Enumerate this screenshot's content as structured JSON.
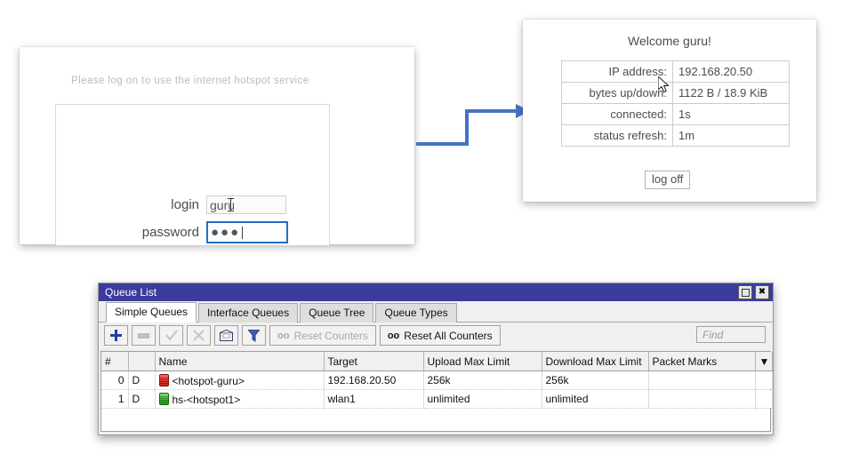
{
  "login_panel": {
    "heading": "Please log on to use the internet hotspot service",
    "login_label": "login",
    "login_value": "guru",
    "password_label": "password",
    "password_value": "●●●"
  },
  "status_panel": {
    "title": "Welcome guru!",
    "rows": [
      {
        "key": "IP address:",
        "value": "192.168.20.50"
      },
      {
        "key": "bytes up/down:",
        "value": "1122 B / 18.9 KiB"
      },
      {
        "key": "connected:",
        "value": "1s"
      },
      {
        "key": "status refresh:",
        "value": "1m"
      }
    ],
    "logoff_label": "log off"
  },
  "connector": {
    "color": "#4472c4"
  },
  "queue_window": {
    "title": "Queue List",
    "window_buttons": {
      "maximize": "maximize-icon",
      "close": "✖"
    },
    "tabs": [
      {
        "label": "Simple Queues",
        "active": true
      },
      {
        "label": "Interface Queues",
        "active": false
      },
      {
        "label": "Queue Tree",
        "active": false
      },
      {
        "label": "Queue Types",
        "active": false
      }
    ],
    "toolbar": {
      "add": "+",
      "remove": "−",
      "enable": "✓",
      "disable": "✗",
      "comment": "comment-icon",
      "filter": "filter-icon",
      "reset_counters_prefix": "oo",
      "reset_counters_label": "Reset Counters",
      "reset_all_counters_prefix": "oo",
      "reset_all_counters_label": "Reset All Counters",
      "find_placeholder": "Find"
    },
    "table": {
      "columns": [
        "#",
        "",
        "Name",
        "Target",
        "Upload Max Limit",
        "Download Max Limit",
        "Packet Marks",
        "▼"
      ],
      "rows": [
        {
          "index": "0",
          "flag": "D",
          "icon_color": "#c91d10",
          "name": "<hotspot-guru>",
          "target": "192.168.20.50",
          "upload_max_limit": "256k",
          "download_max_limit": "256k",
          "packet_marks": ""
        },
        {
          "index": "1",
          "flag": "D",
          "icon_color": "#18a410",
          "name": "hs-<hotspot1>",
          "target": "wlan1",
          "upload_max_limit": "unlimited",
          "download_max_limit": "unlimited",
          "packet_marks": ""
        }
      ]
    }
  }
}
